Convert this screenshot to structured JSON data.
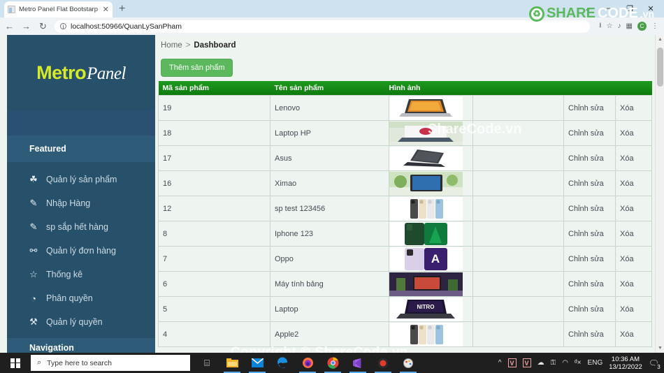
{
  "browser": {
    "tab_title": "Metro Panel Flat Bootstarp Respo",
    "tab_close": "✕",
    "new_tab": "+",
    "back": "←",
    "forward": "→",
    "reload": "↻",
    "info_icon": "ⓘ",
    "url": "localhost:50966/QuanLySanPham",
    "win_min": "–",
    "win_max": "❐",
    "win_close": "✕",
    "win_chevron": "⌄",
    "toolbar_icons": [
      "share-icon",
      "bookmark-star-icon",
      "media-icon",
      "reading-list-icon",
      "profile-icon",
      "menu-icon"
    ],
    "star": "☆",
    "menu": "⋮",
    "profile_initial": "C"
  },
  "sidebar": {
    "brand_first": "Metro",
    "brand_second": "Panel",
    "section_featured": "Featured",
    "section_navigation": "Navigation",
    "items": [
      {
        "label": "Quản lý sản phẩm",
        "icon": "☘",
        "icon_name": "clover-icon"
      },
      {
        "label": "Nhập Hàng",
        "icon": "✎",
        "icon_name": "edit-square-icon"
      },
      {
        "label": "sp sắp hết hàng",
        "icon": "✎",
        "icon_name": "edit-square-icon"
      },
      {
        "label": "Quản lý đơn hàng",
        "icon": "⚯",
        "icon_name": "users-icon"
      },
      {
        "label": "Thống kê",
        "icon": "☆",
        "icon_name": "star-icon"
      },
      {
        "label": "Phân quyền",
        "icon": "◔",
        "icon_name": "gauge-icon"
      },
      {
        "label": "Quản lý quyền",
        "icon": "⚒",
        "icon_name": "wrench-icon"
      }
    ]
  },
  "breadcrumb": {
    "home": "Home",
    "separator": ">",
    "current": "Dashboard"
  },
  "toolbar": {
    "add_product_label": "Thêm sản phẩm"
  },
  "table": {
    "columns": [
      "Mã sản phẩm",
      "Tên sản phẩm",
      "Hình ảnh",
      "",
      "",
      ""
    ],
    "edit_label": "Chỉnh sửa",
    "delete_label": "Xóa",
    "rows": [
      {
        "id": "19",
        "name": "Lenovo",
        "image": "laptop-lenovo-thumbnail"
      },
      {
        "id": "18",
        "name": "Laptop HP",
        "image": "laptop-hp-thumbnail"
      },
      {
        "id": "17",
        "name": "Asus",
        "image": "laptop-asus-thumbnail"
      },
      {
        "id": "16",
        "name": "Ximao",
        "image": "tablet-ximao-thumbnail"
      },
      {
        "id": "12",
        "name": "sp test 123456",
        "image": "iphone-colors-thumbnail"
      },
      {
        "id": "8",
        "name": "Iphone 123",
        "image": "iphone-green-thumbnail"
      },
      {
        "id": "7",
        "name": "Oppo",
        "image": "oppo-purple-thumbnail"
      },
      {
        "id": "6",
        "name": "Máy tính bảng",
        "image": "tablet-desk-thumbnail"
      },
      {
        "id": "5",
        "name": "Laptop",
        "image": "acer-nitro-thumbnail"
      },
      {
        "id": "4",
        "name": "Apple2",
        "image": "iphone-colors-thumbnail"
      }
    ]
  },
  "watermarks": {
    "table_overlay": "ShareCode.vn",
    "bottom_overlay": "Copyright © ShareCode.vn",
    "logo_part1": "SHARE",
    "logo_part2": "CODE",
    "logo_part3": ".vn"
  },
  "taskbar": {
    "search_placeholder": "Type here to search",
    "search_icon": "⌕",
    "task_view_icon": "⌸",
    "apps": [
      "file-explorer-icon",
      "mail-icon",
      "edge-icon",
      "firefox-icon",
      "chrome-icon",
      "visual-studio-icon",
      "record-icon",
      "paint-icon"
    ],
    "tray_up": "^",
    "tray_v1": "V",
    "tray_v2": "V",
    "tray_cloud": "☁",
    "tray_key": "⚿",
    "tray_wifi": "◠",
    "tray_volume": "ᵈ×",
    "language": "ENG",
    "time": "10:36 AM",
    "date": "13/12/2022",
    "notification_count": "3"
  },
  "colors": {
    "sidebar_bg": "#27506a",
    "sidebar_section": "#2d5b78",
    "brand_accent": "#d6ea2a",
    "table_header_green": "#0d7a0d",
    "button_green": "#5cb85c",
    "page_bg": "#eef5f0"
  }
}
